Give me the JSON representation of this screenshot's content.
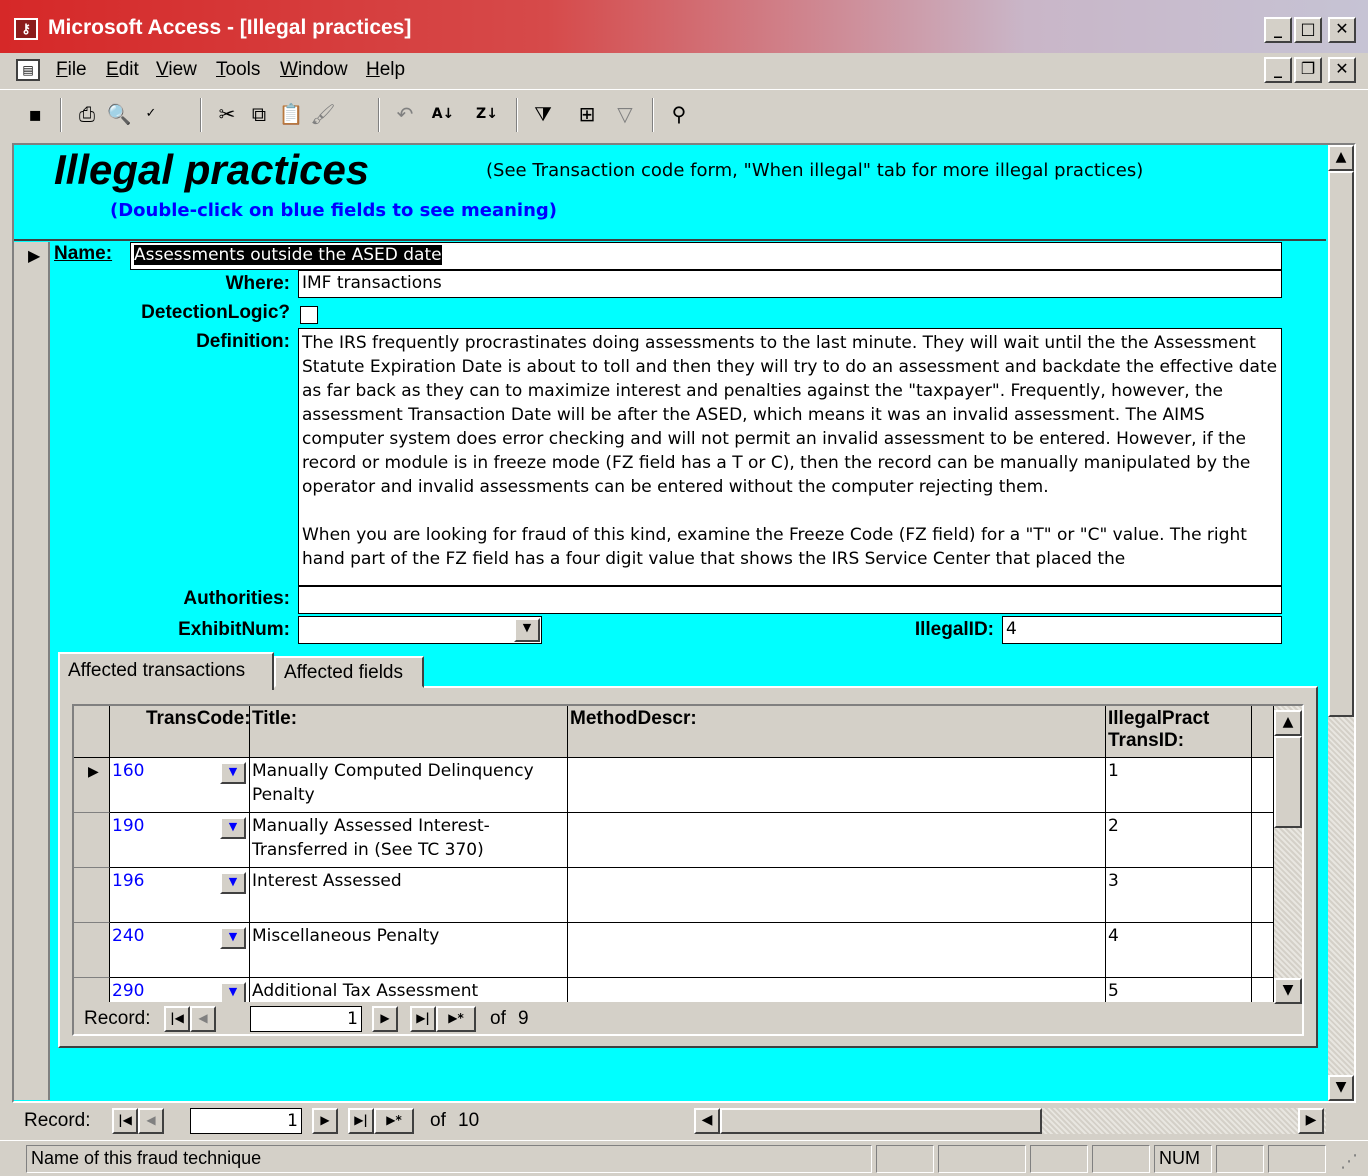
{
  "window": {
    "title": "Microsoft Access - [Illegal practices]",
    "controls": {
      "minimize": "_",
      "maximize": "□",
      "close": "✕",
      "restore": "❐"
    }
  },
  "menu": [
    "File",
    "Edit",
    "View",
    "Tools",
    "Window",
    "Help"
  ],
  "toolbar": [
    "save-icon",
    "print-icon",
    "print-preview-icon",
    "spelling-icon",
    "cut-icon",
    "copy-icon",
    "paste-icon",
    "format-painter-icon",
    "undo-icon",
    "sort-ascending-icon",
    "sort-descending-icon",
    "filter-by-selection-icon",
    "filter-by-form-icon",
    "apply-filter-icon",
    "find-icon"
  ],
  "form": {
    "title": "Illegal practices",
    "note": "(See Transaction code form, \"When illegal\" tab for more illegal practices)",
    "hint": "(Double-click on blue fields to see meaning)",
    "labels": {
      "name": "Name:",
      "where": "Where:",
      "detection": "DetectionLogic?",
      "definition": "Definition:",
      "authorities": "Authorities:",
      "exhibit": "ExhibitNum:",
      "illegal_id": "IllegalID:"
    },
    "values": {
      "name": "Assessments outside the ASED date",
      "where": "IMF transactions",
      "detection_checked": false,
      "definition_p1": "The IRS frequently procrastinates doing assessments to the last minute.  They will wait until the the Assessment Statute Expiration Date is about to toll and then they will try to do an assessment and backdate the effective date as far back as they can to maximize interest and penalties against the \"taxpayer\".  Frequently, however, the assessment Transaction Date will be after the ASED, which means it was an invalid assessment.  The AIMS computer system does error checking and will not permit an invalid assessment to be entered.  However, if the record or module is in freeze mode (FZ field has a T or C), then the record can be manually manipulated by the operator and invalid assessments can be entered without the computer rejecting them.",
      "definition_p2": "When you are looking for fraud of this kind, examine the Freeze Code (FZ field) for a \"T\" or \"C\" value.  The right hand part of the FZ field has a four digit value that shows the IRS Service Center that placed the",
      "authorities": "",
      "exhibit": "",
      "illegal_id": "4"
    }
  },
  "tabs": [
    "Affected transactions",
    "Affected fields"
  ],
  "subform": {
    "columns": [
      "TransCode:",
      "Title:",
      "MethodDescr:",
      "IllegalPract TransID:"
    ],
    "rows": [
      {
        "code": "160",
        "title": "Manually Computed Delinquency Penalty",
        "method": "",
        "id": "1"
      },
      {
        "code": "190",
        "title": "Manually Assessed Interest-Transferred in (See TC 370)",
        "method": "",
        "id": "2"
      },
      {
        "code": "196",
        "title": "Interest Assessed",
        "method": "",
        "id": "3"
      },
      {
        "code": "240",
        "title": "Miscellaneous Penalty",
        "method": "",
        "id": "4"
      },
      {
        "code": "290",
        "title": "Additional Tax Assessment",
        "method": "",
        "id": "5"
      }
    ],
    "nav": {
      "label": "Record:",
      "current": "1",
      "of_label": "of",
      "total": "9"
    }
  },
  "main_nav": {
    "label": "Record:",
    "current": "1",
    "of_label": "of",
    "total": "10"
  },
  "status": {
    "text": "Name of this fraud technique",
    "num": "NUM"
  },
  "colors": {
    "form_bg": "#00ffff",
    "title_red": "#d62828",
    "link_blue": "#0000ff"
  }
}
